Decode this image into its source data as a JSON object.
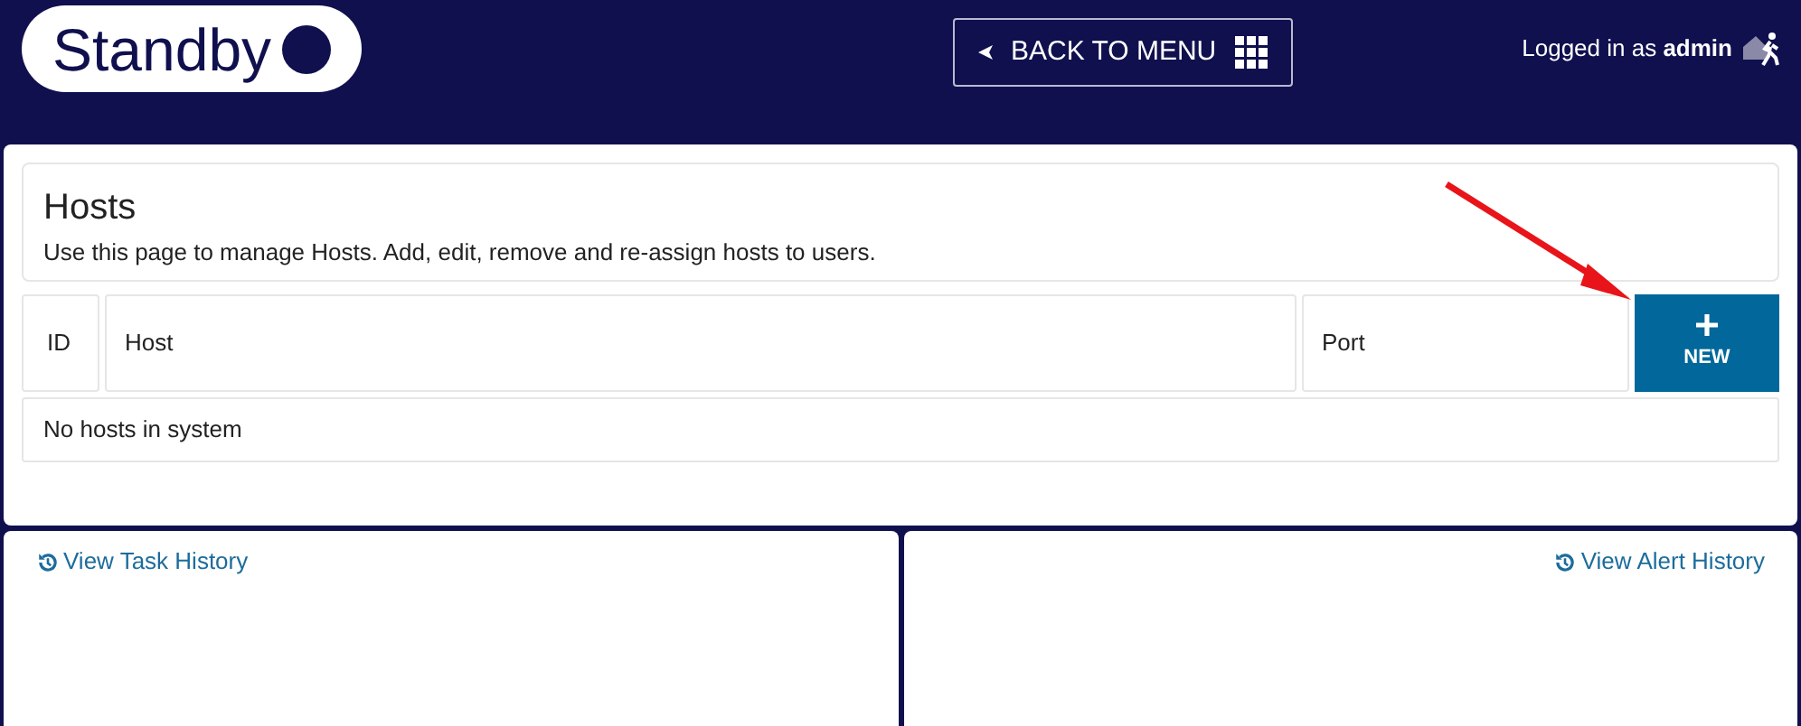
{
  "header": {
    "logo": "Standby",
    "back_button": "BACK TO MENU",
    "login": "Logged in as **admin**"
  },
  "hosts": {
    "title": "Hosts",
    "description": "Use this page to manage Hosts. Add, edit, remove and re-assign hosts to users.",
    "columns": [
      "ID",
      "Host",
      "Port"
    ],
    "new_button": "NEW",
    "empty_message": "No hosts in system"
  },
  "panels": [
    {
      "link": "View Task History"
    },
    {
      "link": "View Alert History"
    }
  ]
}
